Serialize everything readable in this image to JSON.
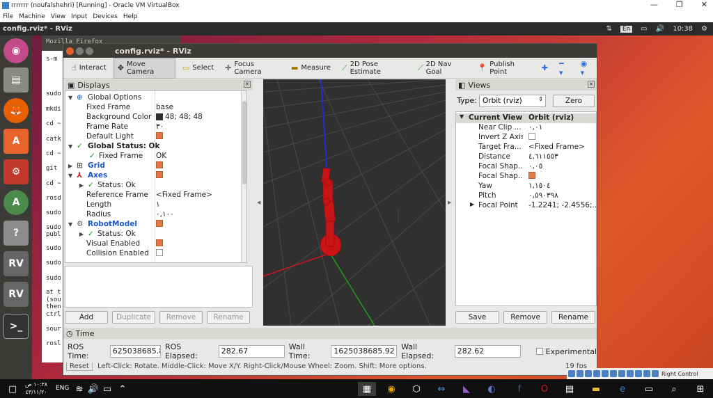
{
  "host": {
    "window_title": "rrrrrrr (noufalshehri) [Running] - Oracle VM VirtualBox",
    "menu": [
      "File",
      "Machine",
      "View",
      "Input",
      "Devices",
      "Help"
    ],
    "status_label": "Right Control"
  },
  "ubuntu_panel": {
    "app_title": "config.rviz* - RViz",
    "keyboard": "En",
    "clock": "10:38"
  },
  "terminal": {
    "title": "Mozilla Firefox",
    "lines": [
      "s-m",
      "sudo",
      "mkdi",
      "cd ~",
      "catk",
      "cd ~",
      "git",
      "cd ~",
      "rosd",
      "sudo",
      "sudo",
      "publ",
      "sudo",
      "sudo",
      "sudo",
      "at t",
      "(sou",
      "then",
      "ctrl",
      "sour",
      "rosl"
    ]
  },
  "rviz": {
    "title": "config.rviz* - RViz",
    "toolbar": {
      "interact": "Interact",
      "move_camera": "Move Camera",
      "select": "Select",
      "focus_camera": "Focus Camera",
      "measure": "Measure",
      "pose_estimate": "2D Pose Estimate",
      "nav_goal": "2D Nav Goal",
      "publish_point": "Publish Point"
    },
    "displays": {
      "title": "Displays",
      "rows": [
        {
          "label": "Global Options",
          "value": ""
        },
        {
          "label": "Fixed Frame",
          "value": "base"
        },
        {
          "label": "Background Color",
          "value": "48; 48; 48"
        },
        {
          "label": "Frame Rate",
          "value": "٣٠"
        },
        {
          "label": "Default Light",
          "value": ""
        },
        {
          "label": "Global Status: Ok",
          "value": ""
        },
        {
          "label": "Fixed Frame",
          "value": "OK"
        },
        {
          "label": "Grid",
          "value": ""
        },
        {
          "label": "Axes",
          "value": ""
        },
        {
          "label": "Status: Ok",
          "value": ""
        },
        {
          "label": "Reference Frame",
          "value": "<Fixed Frame>"
        },
        {
          "label": "Length",
          "value": "١"
        },
        {
          "label": "Radius",
          "value": "٠,١٠٠"
        },
        {
          "label": "RobotModel",
          "value": ""
        },
        {
          "label": "Status: Ok",
          "value": ""
        },
        {
          "label": "Visual Enabled",
          "value": ""
        },
        {
          "label": "Collision Enabled",
          "value": ""
        }
      ],
      "buttons": {
        "add": "Add",
        "duplicate": "Duplicate",
        "remove": "Remove",
        "rename": "Rename"
      }
    },
    "views": {
      "title": "Views",
      "type_label": "Type:",
      "type_value": "Orbit (rviz)",
      "zero": "Zero",
      "current_view": {
        "label": "Current View",
        "value": "Orbit (rviz)"
      },
      "rows": [
        {
          "label": "Near Clip ...",
          "value": "٠,٠١"
        },
        {
          "label": "Invert Z Axis",
          "value": ""
        },
        {
          "label": "Target Fra...",
          "value": "<Fixed Frame>"
        },
        {
          "label": "Distance",
          "value": "٤,٦١١٥٥٣"
        },
        {
          "label": "Focal Shap...",
          "value": "٠,٠٥"
        },
        {
          "label": "Focal Shap...",
          "value": ""
        },
        {
          "label": "Yaw",
          "value": "١,١٥٠٤"
        },
        {
          "label": "Pitch",
          "value": "٠,٥٩٠٣٩٨"
        },
        {
          "label": "Focal Point",
          "value": "-1.2241; -2.4556;..."
        }
      ],
      "buttons": {
        "save": "Save",
        "remove": "Remove",
        "rename": "Rename"
      }
    },
    "time": {
      "title": "Time",
      "ros_time_label": "ROS Time:",
      "ros_time": "625038685.87",
      "ros_elapsed_label": "ROS Elapsed:",
      "ros_elapsed": "282.67",
      "wall_time_label": "Wall Time:",
      "wall_time": "1625038685.92",
      "wall_elapsed_label": "Wall Elapsed:",
      "wall_elapsed": "282.62",
      "experimental": "Experimental"
    },
    "status_bar": {
      "reset": "Reset",
      "hint": "Left-Click: Rotate.  Middle-Click: Move X/Y.  Right-Click/Mouse Wheel: Zoom.  Shift: More options.",
      "fps": "19 fps"
    }
  },
  "taskbar": {
    "time": "١٠:٣٨ ص",
    "date": "٤٣/١١/٢٠",
    "lang": "ENG"
  },
  "colors": {
    "rviz_bg": "#303030",
    "robot": "#c81414",
    "checkbox": "#e07b45"
  }
}
